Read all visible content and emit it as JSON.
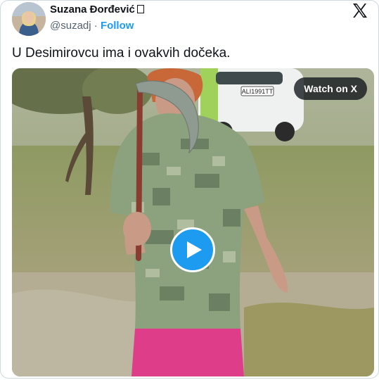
{
  "author": {
    "display_name": "Suzana Đorđević",
    "handle": "@suzadj",
    "separator": "·",
    "follow_label": "Follow"
  },
  "tweet": {
    "text": "U Desimirovcu ima i ovakvih dočeka."
  },
  "media": {
    "watch_label": "Watch on X",
    "license_plate": "ALI1991TT"
  },
  "colors": {
    "accent": "#1d9bf0",
    "text": "#0f1419",
    "muted": "#536471",
    "border": "#cfd9de"
  },
  "icons": {
    "brand": "x-logo-icon",
    "play": "play-icon",
    "verified_flag": "flag-icon"
  }
}
